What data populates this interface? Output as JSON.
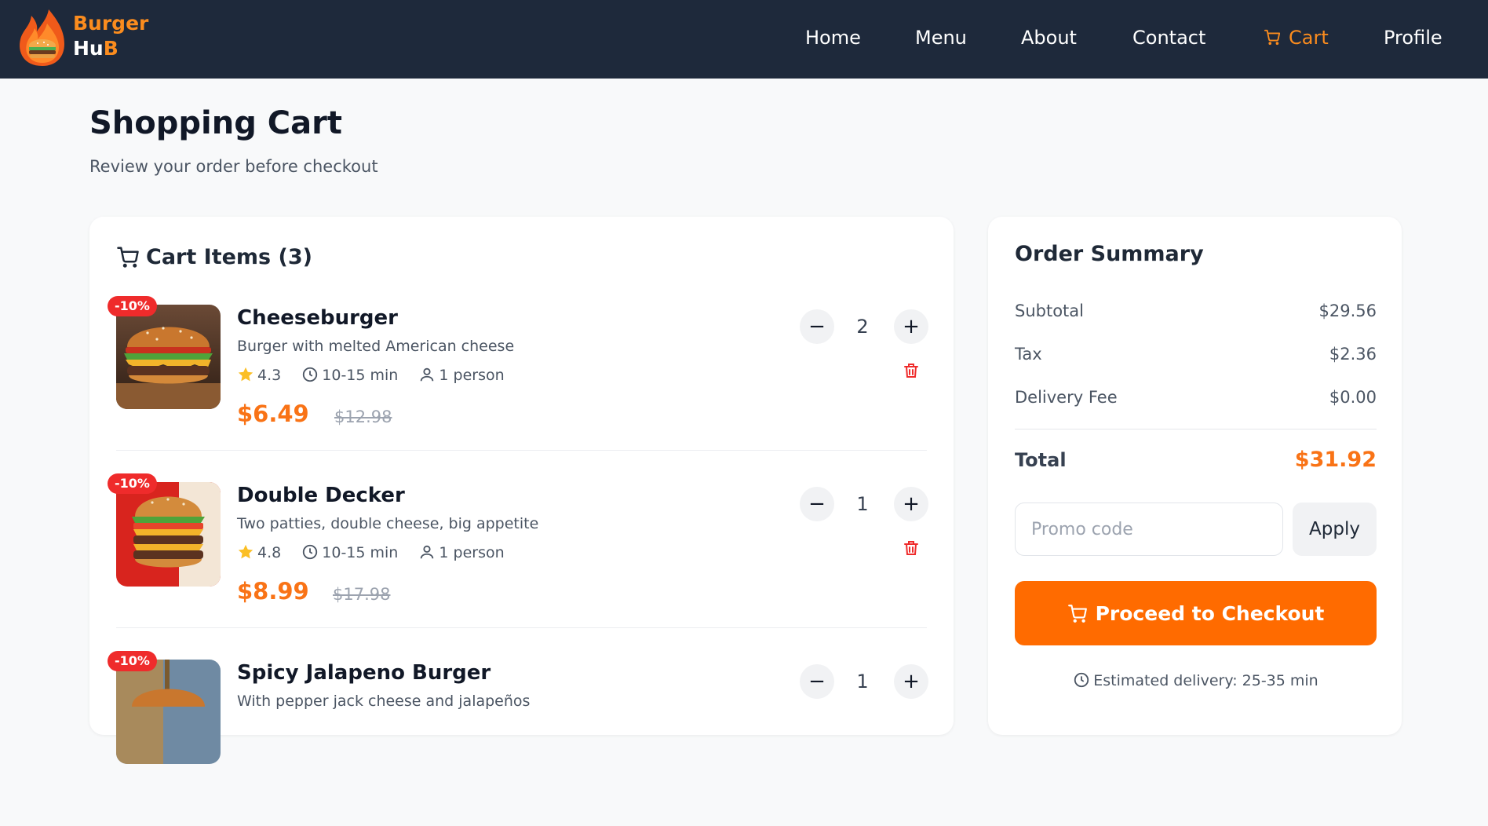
{
  "header": {
    "brand_line1": "Burger",
    "brand_line2_a": "Hu",
    "brand_line2_b": "B",
    "nav": [
      {
        "label": "Home"
      },
      {
        "label": "Menu"
      },
      {
        "label": "About"
      },
      {
        "label": "Contact"
      },
      {
        "label": "Cart"
      },
      {
        "label": "Profile"
      }
    ],
    "active_nav": "Cart"
  },
  "page": {
    "title": "Shopping Cart",
    "subtitle": "Review your order before checkout"
  },
  "cart": {
    "heading": "Cart Items (3)",
    "items": [
      {
        "badge": "-10%",
        "name": "Cheeseburger",
        "description": "Burger with melted American cheese",
        "rating": "4.3",
        "time": "10-15 min",
        "serves": "1 person",
        "price": "$6.49",
        "old_price": "$12.98",
        "qty": "2"
      },
      {
        "badge": "-10%",
        "name": "Double Decker",
        "description": "Two patties, double cheese, big appetite",
        "rating": "4.8",
        "time": "10-15 min",
        "serves": "1 person",
        "price": "$8.99",
        "old_price": "$17.98",
        "qty": "1"
      },
      {
        "badge": "-10%",
        "name": "Spicy Jalapeno Burger",
        "description": "With pepper jack cheese and jalapeños",
        "qty": "1"
      }
    ]
  },
  "summary": {
    "title": "Order Summary",
    "subtotal_label": "Subtotal",
    "subtotal": "$29.56",
    "tax_label": "Tax",
    "tax": "$2.36",
    "delivery_label": "Delivery Fee",
    "delivery": "$0.00",
    "total_label": "Total",
    "total": "$31.92",
    "promo_placeholder": "Promo code",
    "apply_label": "Apply",
    "checkout_label": "Proceed to Checkout",
    "eta": "Estimated delivery: 25-35 min"
  },
  "colors": {
    "header_bg": "#1e293b",
    "accent": "#ff6b00",
    "price": "#f97316",
    "badge": "#ef2b2b"
  },
  "icons": [
    "burger-logo-icon",
    "cart-icon",
    "star-icon",
    "clock-icon",
    "person-icon",
    "trash-icon",
    "minus-icon",
    "plus-icon"
  ]
}
